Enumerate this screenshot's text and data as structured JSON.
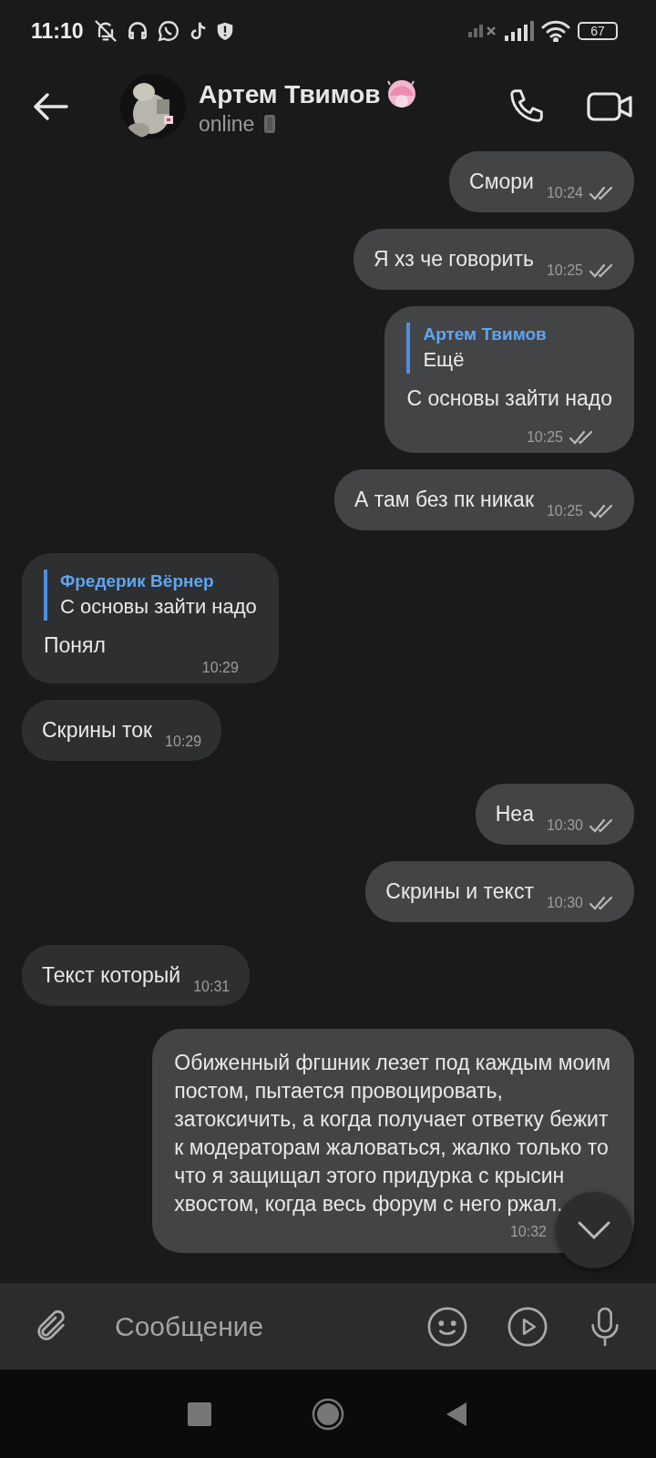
{
  "status_bar": {
    "time": "11:10",
    "battery": "67"
  },
  "header": {
    "name": "Артем Твимов",
    "status": "online"
  },
  "messages": [
    {
      "kind": "outgoing",
      "text": "Смори",
      "time": "10:24",
      "read": true
    },
    {
      "kind": "outgoing",
      "text": "Я хз че говорить",
      "time": "10:25",
      "read": true
    },
    {
      "kind": "outgoing",
      "reply": {
        "author": "Артем Твимов",
        "text": "Ещё"
      },
      "text": "С основы зайти надо",
      "time": "10:25",
      "read": true
    },
    {
      "kind": "outgoing",
      "text": "А там без пк никак",
      "time": "10:25",
      "read": true
    },
    {
      "kind": "incoming",
      "reply": {
        "author": "Фредерик Вёрнер",
        "text": "С основы зайти надо"
      },
      "text": "Понял",
      "time": "10:29"
    },
    {
      "kind": "incoming",
      "text": "Скрины ток",
      "time": "10:29"
    },
    {
      "kind": "outgoing",
      "text": "Неа",
      "time": "10:30",
      "read": true
    },
    {
      "kind": "outgoing",
      "text": "Скрины и текст",
      "time": "10:30",
      "read": true
    },
    {
      "kind": "incoming",
      "text": "Текст который",
      "time": "10:31"
    },
    {
      "kind": "outgoing",
      "text": "Обиженный фгшник лезет под каждым моим\nпостом, пытается провоцировать,\nзатоксичить, а когда получает ответку бежит\nк модераторам жаловаться, жалко только то\nчто я защищал этого придурка с крысин\nхвостом, когда весь форум с него ржал.",
      "time": "10:32"
    }
  ],
  "composer": {
    "placeholder": "Сообщение"
  }
}
